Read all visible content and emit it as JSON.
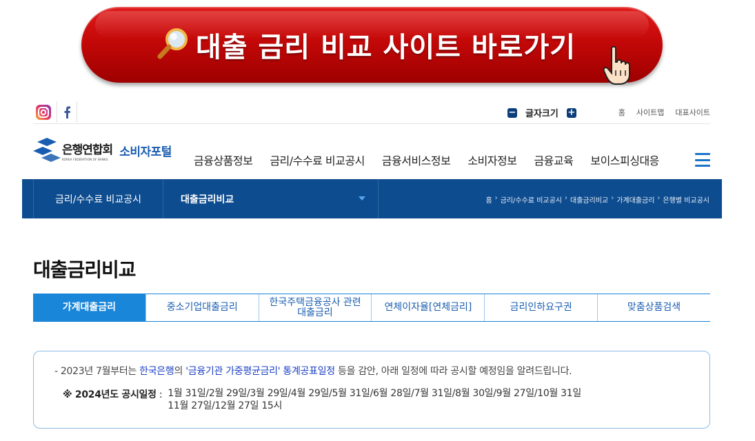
{
  "promo": {
    "text": "대출 금리 비교 사이트 바로가기"
  },
  "utility": {
    "font_size_label": "글자크기",
    "minus": "−",
    "plus": "+",
    "links": [
      "홈",
      "사이트맵",
      "대표사이트"
    ]
  },
  "logo": {
    "org_ko": "은행연합회",
    "org_en": "KOREA FEDERATION OF BANKS",
    "portal": "소비자포털"
  },
  "gnb": {
    "menu": [
      "금융상품정보",
      "금리/수수료 비교공시",
      "금융서비스정보",
      "소비자정보",
      "금융교육",
      "보이스피싱대응"
    ]
  },
  "subbar": {
    "section": "금리/수수료 비교공시",
    "selected": "대출금리비교",
    "breadcrumb": [
      "홈",
      "금리/수수료 비교공시",
      "대출금리비교",
      "가계대출금리",
      "은행별 비교공시"
    ]
  },
  "page": {
    "title": "대출금리비교"
  },
  "tabs": [
    {
      "line1": "가계대출금리",
      "line2": "",
      "active": true
    },
    {
      "line1": "중소기업대출금리",
      "line2": "",
      "active": false
    },
    {
      "line1": "한국주택금융공사 관련",
      "line2": "대출금리",
      "active": false
    },
    {
      "line1": "연체이자율[연체금리]",
      "line2": "",
      "active": false
    },
    {
      "line1": "금리인하요구권",
      "line2": "",
      "active": false
    },
    {
      "line1": "맞춤상품검색",
      "line2": "",
      "active": false
    }
  ],
  "notice": {
    "prefix": "- 2023년 7월부터는 ",
    "bok": "한국은행",
    "mid1": "의 ",
    "stat": "'금융기관 가중평균금리' 통계공표일정",
    "suffix": " 등을 감안, 아래 일정에 따라 공시할 예정임을 알려드립니다.",
    "schedule_label": "※ 2024년도 공시일정",
    "schedule_colon": " : ",
    "schedule_line1": "1월 31일/2월 29일/3월 29일/4월 29일/5월 31일/6월 28일/7월 31일/8월 30일/9월 27일/10월 31일",
    "schedule_line2": "11월 27일/12월 27일 15시"
  },
  "colors": {
    "primary_navy": "#0d4c8f",
    "tab_active": "#1a86d9",
    "promo_red": "#c40808",
    "link_blue": "#1a3fc4"
  }
}
